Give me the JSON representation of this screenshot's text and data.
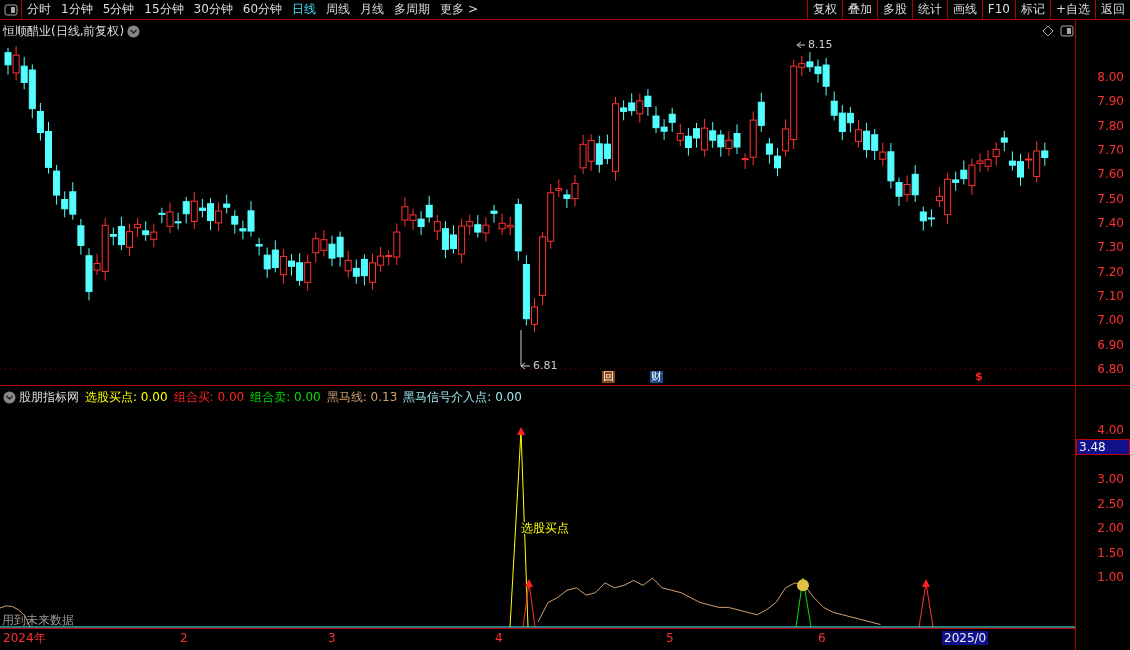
{
  "toolbar": {
    "periods": [
      {
        "label": "分时",
        "selected": false
      },
      {
        "label": "1分钟",
        "selected": false
      },
      {
        "label": "5分钟",
        "selected": false
      },
      {
        "label": "15分钟",
        "selected": false
      },
      {
        "label": "30分钟",
        "selected": false
      },
      {
        "label": "60分钟",
        "selected": false
      },
      {
        "label": "日线",
        "selected": true
      },
      {
        "label": "周线",
        "selected": false
      },
      {
        "label": "月线",
        "selected": false
      },
      {
        "label": "多周期",
        "selected": false
      },
      {
        "label": "更多 >",
        "selected": false
      }
    ],
    "actions": [
      "复权",
      "叠加",
      "多股",
      "统计",
      "画线",
      "F10",
      "标记",
      "+自选",
      "返回"
    ]
  },
  "price_chart": {
    "title": "恒顺醋业(日线,前复权)",
    "high_label": "8.15",
    "low_label": "6.81",
    "markers": [
      {
        "kind": "box",
        "text": "回",
        "color": "#8b4513"
      },
      {
        "kind": "box",
        "text": "财",
        "color": "#1c4f8a"
      },
      {
        "kind": "plain",
        "text": "$",
        "color": "#ff2020"
      }
    ],
    "yticks": [
      "8.00",
      "7.90",
      "7.80",
      "7.70",
      "7.60",
      "7.50",
      "7.40",
      "7.30",
      "7.20",
      "7.10",
      "7.00",
      "6.90",
      "6.80"
    ]
  },
  "indicator": {
    "name": "股朋指标网",
    "items": [
      {
        "label": "选股买点:",
        "value": "0.00",
        "color": "#ffff00"
      },
      {
        "label": "组合买:",
        "value": "0.00",
        "color": "#ff2020"
      },
      {
        "label": "组合卖:",
        "value": "0.00",
        "color": "#00e000"
      },
      {
        "label": "黑马线:",
        "value": "0.13",
        "color": "#d0a070"
      },
      {
        "label": "黑马信号介入点:",
        "value": "0.00",
        "color": "#a0e8f0"
      }
    ],
    "signal_label": "选股买点",
    "note": "用到未来数据",
    "current_value": "3.48",
    "yticks": [
      "4.00",
      "3.00",
      "2.50",
      "2.00",
      "1.50",
      "1.00"
    ]
  },
  "x_axis": {
    "labels": [
      "2024年",
      "2",
      "3",
      "4",
      "5",
      "6"
    ],
    "last_label": "2025/0"
  }
}
